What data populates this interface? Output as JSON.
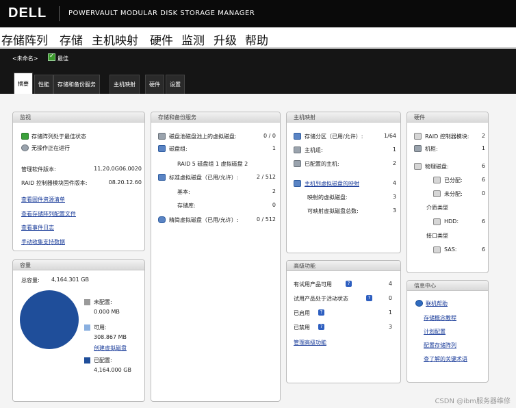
{
  "header": {
    "logo": "DELL",
    "product": "POWERVAULT MODULAR DISK STORAGE MANAGER"
  },
  "menu": [
    "存储阵列",
    "存储",
    "主机映射",
    "硬件",
    "监测",
    "升级",
    "帮助"
  ],
  "subbar": {
    "array_name": "<未命名>",
    "status": "最佳"
  },
  "tabs": [
    "摘要",
    "性能",
    "存储和备份服务",
    "主机映射",
    "硬件",
    "设置"
  ],
  "monitor": {
    "title": "监视",
    "status_optimal": "存储阵列处于最佳状态",
    "no_ops": "无操作正在进行",
    "mgmt_version_label": "管理软件版本:",
    "mgmt_version": "11.20.0G06.0020",
    "fw_version_label": "RAID 控制器模块固件版本:",
    "fw_version": "08.20.12.60",
    "links": [
      "查看固件资源清单",
      "查看存储阵列配置文件",
      "查看事件日志",
      "手动收集支持数据"
    ]
  },
  "capacity": {
    "title": "容量",
    "total_label": "总容量:",
    "total": "4,164.301 GB",
    "unconfigured_label": "未配置:",
    "unconfigured": "0.000 MB",
    "free_label": "可用:",
    "free": "308.867 MB",
    "create_link": "创建虚拟磁盘",
    "configured_label": "已配置:",
    "configured": "4,164.000 GB"
  },
  "chart_data": {
    "type": "pie",
    "series": [
      {
        "name": "未配置",
        "value": 0,
        "color": "#9a9a9a"
      },
      {
        "name": "可用",
        "value": 0.308867,
        "color": "#8ab0e0"
      },
      {
        "name": "已配置",
        "value": 4164,
        "color": "#1f4e9a"
      }
    ]
  },
  "storage": {
    "title": "存储和备份服务",
    "rows": [
      {
        "label": "磁盘池磁盘池上的虚拟磁盘:",
        "value": "0 / 0"
      },
      {
        "label": "磁盘组:",
        "value": "1"
      },
      {
        "label": "RAID 5 磁盘组 1 虚拟磁盘 2",
        "value": ""
      },
      {
        "label": "标准虚拟磁盘（已用/允许）:",
        "value": "2 / 512"
      },
      {
        "label": "基本:",
        "value": "2"
      },
      {
        "label": "存储库:",
        "value": "0"
      },
      {
        "label": "精简虚拟磁盘（已用/允许）:",
        "value": "0 / 512"
      }
    ]
  },
  "hostmap": {
    "title": "主机映射",
    "rows": [
      {
        "label": "存储分区（已用/允许）:",
        "value": "1/64"
      },
      {
        "label": "主机组:",
        "value": "1"
      },
      {
        "label": "已配置的主机:",
        "value": "2"
      },
      {
        "label": "主机到虚拟磁盘的映射",
        "value": "4"
      },
      {
        "label": "映射的虚拟磁盘:",
        "value": "3"
      },
      {
        "label": "可映射虚拟磁盘总数:",
        "value": "3"
      }
    ]
  },
  "premium": {
    "title": "高级功能",
    "rows": [
      {
        "label": "有试用产品可用",
        "value": "4"
      },
      {
        "label": "试用产品处于活动状态",
        "value": "0"
      },
      {
        "label": "已启用",
        "value": "1"
      },
      {
        "label": "已禁用",
        "value": "3"
      }
    ],
    "manage_link": "管理高级功能"
  },
  "hardware": {
    "title": "硬件",
    "rows": [
      {
        "label": "RAID 控制器模块:",
        "value": "2"
      },
      {
        "label": "机柜:",
        "value": "1"
      },
      {
        "label": "物理磁盘:",
        "value": "6"
      },
      {
        "label": "已分配:",
        "value": "6"
      },
      {
        "label": "未分配:",
        "value": "0"
      },
      {
        "label": "介质类型",
        "value": ""
      },
      {
        "label": "HDD:",
        "value": "6"
      },
      {
        "label": "接口类型",
        "value": ""
      },
      {
        "label": "SAS:",
        "value": "6"
      }
    ]
  },
  "info": {
    "title": "信息中心",
    "links": [
      "联机帮助",
      "存储概念教程",
      "计划配置",
      "配置存储阵列",
      "查了解的关键术语"
    ]
  },
  "watermark": "CSDN @ibm服务器维修"
}
